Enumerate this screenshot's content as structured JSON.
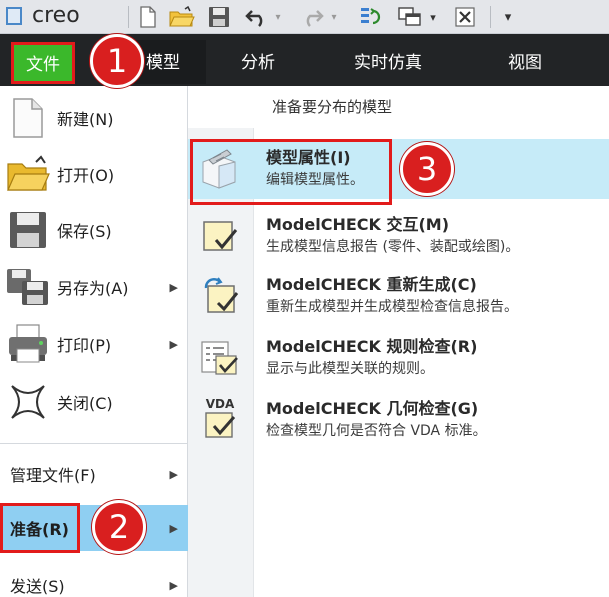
{
  "app": {
    "logo": "creo"
  },
  "toolbar": {
    "more": "▾"
  },
  "ribbon": {
    "file_tab": "文件",
    "tabs": [
      "模型",
      "分析",
      "实时仿真",
      "视图"
    ]
  },
  "file_menu": {
    "items": [
      {
        "label": "新建(N)",
        "icon": "new-file-icon",
        "submenu": false
      },
      {
        "label": "打开(O)",
        "icon": "open-folder-icon",
        "submenu": false
      },
      {
        "label": "保存(S)",
        "icon": "save-icon",
        "submenu": false
      },
      {
        "label": "另存为(A)",
        "icon": "save-as-icon",
        "submenu": true
      },
      {
        "label": "打印(P)",
        "icon": "print-icon",
        "submenu": true
      },
      {
        "label": "关闭(C)",
        "icon": "close-icon",
        "submenu": false
      }
    ],
    "lower_items": [
      {
        "label": "管理文件(F)",
        "submenu": true
      },
      {
        "label": "准备(R)",
        "submenu": true,
        "selected": true
      },
      {
        "label": "发送(S)",
        "submenu": true
      }
    ]
  },
  "prepare_submenu": {
    "header": "准备要分布的模型",
    "items": [
      {
        "title": "模型属性(I)",
        "description": "编辑模型属性。",
        "icon": "model-properties-icon",
        "highlighted": true
      },
      {
        "title": "ModelCHECK 交互(M)",
        "description": "生成模型信息报告 (零件、装配或绘图)。",
        "icon": "modelcheck-interactive-icon",
        "highlighted": false
      },
      {
        "title": "ModelCHECK 重新生成(C)",
        "description": "重新生成模型并生成模型检查信息报告。",
        "icon": "modelcheck-regenerate-icon",
        "highlighted": false
      },
      {
        "title": "ModelCHECK 规则检查(R)",
        "description": "显示与此模型关联的规则。",
        "icon": "modelcheck-rules-icon",
        "highlighted": false
      },
      {
        "title": "ModelCHECK 几何检查(G)",
        "description": "检查模型几何是否符合 VDA 标准。",
        "icon": "modelcheck-geometry-icon",
        "icon_text": "VDA",
        "highlighted": false
      }
    ]
  },
  "annotations": {
    "steps": [
      "1",
      "2",
      "3"
    ],
    "color": "#e21b1b"
  },
  "colors": {
    "file_tab": "#3bb82b",
    "ribbon_bg": "#222426",
    "selected_item": "#8fcff2",
    "highlight_item": "#c6ebf8"
  }
}
